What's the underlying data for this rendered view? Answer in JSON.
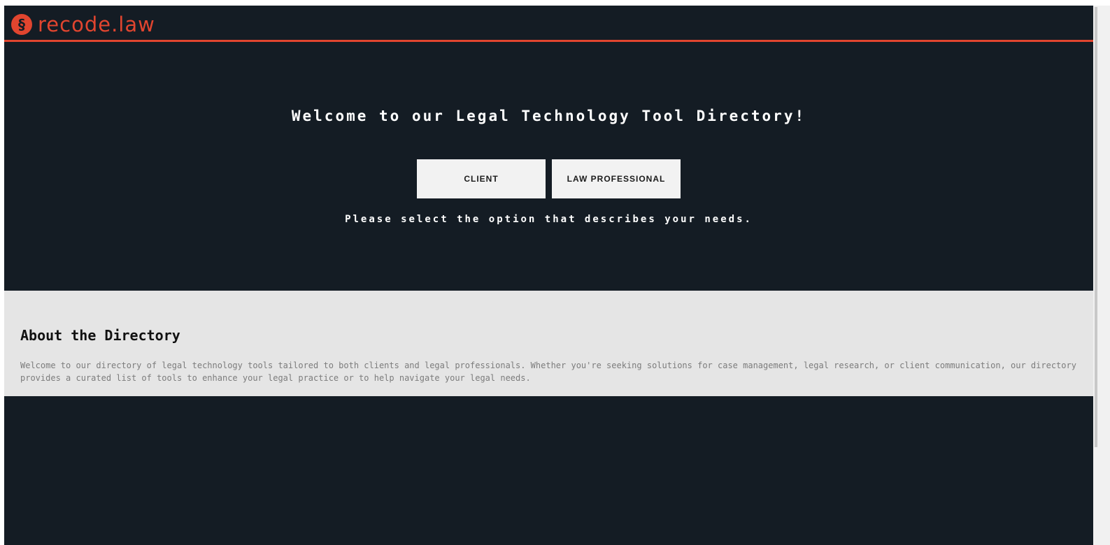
{
  "brand": {
    "name": "recode.law",
    "accent_color": "#e1452f",
    "logo_icon": "section-sign-icon"
  },
  "hero": {
    "title": "Welcome to our Legal Technology Tool Directory!",
    "buttons": {
      "client_label": "CLIENT",
      "professional_label": "LAW PROFESSIONAL"
    },
    "subtitle": "Please select the option that describes your needs."
  },
  "about": {
    "heading": "About the Directory",
    "body": "Welcome to our directory of legal technology tools tailored to both clients and legal professionals. Whether you're seeking solutions for case management, legal research, or client communication, our directory provides a curated list of tools to enhance your legal practice or to help navigate your legal needs."
  },
  "colors": {
    "background_dark": "#141c24",
    "about_background": "#e5e5e5",
    "button_background": "#f2f2f2"
  }
}
